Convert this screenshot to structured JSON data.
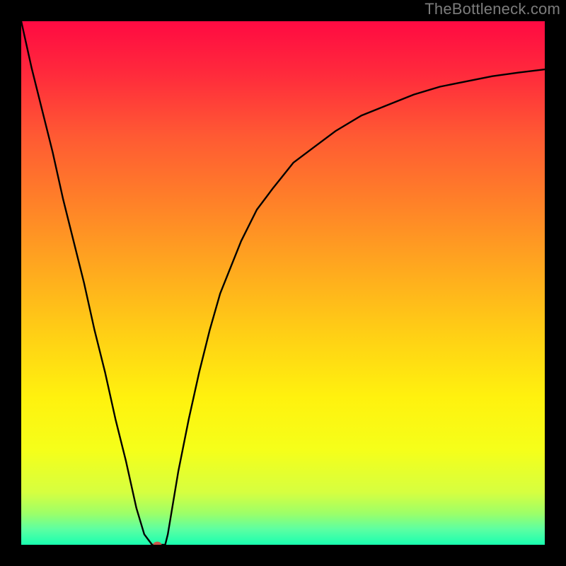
{
  "watermark": "TheBottleneck.com",
  "chart_data": {
    "type": "line",
    "title": "",
    "xlabel": "",
    "ylabel": "",
    "xlim": [
      0,
      100
    ],
    "ylim": [
      0,
      100
    ],
    "grid": false,
    "series": [
      {
        "name": "curve",
        "stroke": "#000000",
        "x": [
          0,
          2,
          4,
          6,
          8,
          10,
          12,
          14,
          16,
          18,
          20,
          22,
          23.5,
          25,
          26.5,
          27.5,
          28,
          29,
          30,
          32,
          34,
          36,
          38,
          40,
          42,
          45,
          48,
          52,
          56,
          60,
          65,
          70,
          75,
          80,
          85,
          90,
          95,
          100
        ],
        "y": [
          100,
          91,
          83,
          75,
          66,
          58,
          50,
          41,
          33,
          24,
          16,
          7,
          2,
          0,
          0,
          0,
          2,
          8,
          14,
          24,
          33,
          41,
          48,
          53,
          58,
          64,
          68,
          73,
          76,
          79,
          82,
          84,
          86,
          87.5,
          88.5,
          89.5,
          90.2,
          90.8
        ]
      }
    ],
    "marker": {
      "x": 26,
      "y": 0,
      "color": "#c9594c",
      "rx": 6,
      "ry": 4.5
    },
    "background_gradient": {
      "direction": "vertical",
      "stops": [
        {
          "offset": 0.0,
          "color": "#ff0a42"
        },
        {
          "offset": 0.1,
          "color": "#ff2a3c"
        },
        {
          "offset": 0.22,
          "color": "#ff5a33"
        },
        {
          "offset": 0.35,
          "color": "#ff8228"
        },
        {
          "offset": 0.48,
          "color": "#ffab1e"
        },
        {
          "offset": 0.6,
          "color": "#ffd015"
        },
        {
          "offset": 0.72,
          "color": "#fff20e"
        },
        {
          "offset": 0.82,
          "color": "#f5ff1a"
        },
        {
          "offset": 0.9,
          "color": "#d6ff40"
        },
        {
          "offset": 0.94,
          "color": "#9dff68"
        },
        {
          "offset": 0.97,
          "color": "#5dffa2"
        },
        {
          "offset": 1.0,
          "color": "#19ffb0"
        }
      ]
    }
  }
}
